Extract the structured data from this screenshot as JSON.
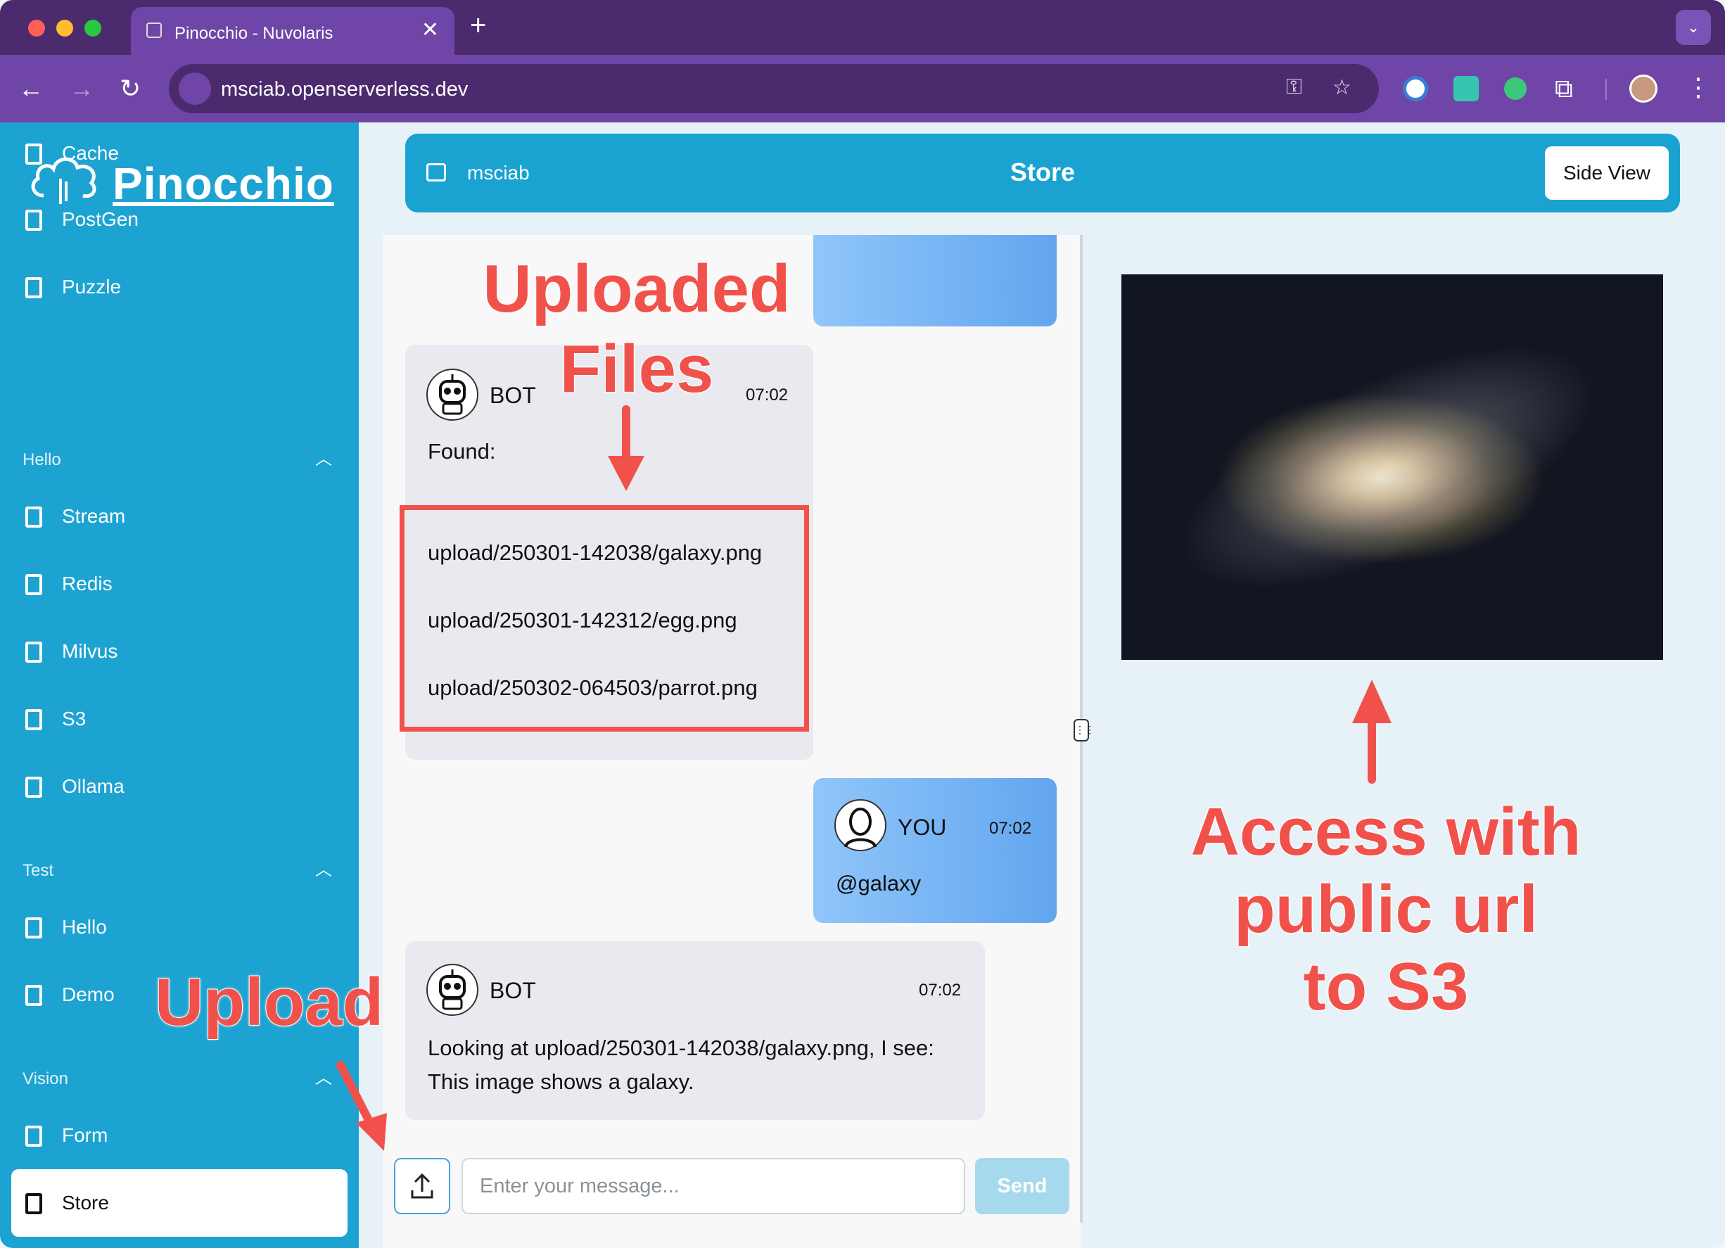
{
  "browser": {
    "tab_title": "Pinocchio - Nuvolaris",
    "url": "msciab.openserverless.dev"
  },
  "sidebar": {
    "logo_text": "Pinocchio",
    "items_top": [
      {
        "label": "Cache"
      },
      {
        "label": "PostGen"
      },
      {
        "label": "Puzzle"
      }
    ],
    "sections": [
      {
        "title": "Hello",
        "items": [
          {
            "label": "Stream"
          },
          {
            "label": "Redis"
          },
          {
            "label": "Milvus"
          },
          {
            "label": "S3"
          },
          {
            "label": "Ollama"
          }
        ]
      },
      {
        "title": "Test",
        "items": [
          {
            "label": "Hello"
          },
          {
            "label": "Demo"
          }
        ]
      },
      {
        "title": "Vision",
        "items": [
          {
            "label": "Form"
          },
          {
            "label": "Store"
          }
        ]
      }
    ],
    "active_item": "Store"
  },
  "header": {
    "workspace": "msciab",
    "page_title": "Store",
    "side_view_label": "Side View"
  },
  "chat": {
    "messages": [
      {
        "sender": "BOT",
        "time": "07:02",
        "text": "Found:",
        "files": [
          "upload/250301-142038/galaxy.png",
          "upload/250301-142312/egg.png",
          "upload/250302-064503/parrot.png"
        ]
      },
      {
        "sender": "YOU",
        "time": "07:02",
        "text": "@galaxy"
      },
      {
        "sender": "BOT",
        "time": "07:02",
        "text_line1": "Looking at upload/250301-142038/galaxy.png, I see:",
        "text_line2": "This image shows a galaxy."
      }
    ],
    "input_placeholder": "Enter your message...",
    "send_label": "Send"
  },
  "annotations": {
    "uploaded_files_line1": "Uploaded",
    "uploaded_files_line2": "Files",
    "upload": "Upload",
    "access_line1": "Access with",
    "access_line2": "public url",
    "access_line3": "to S3"
  },
  "colors": {
    "accent": "#1da3d1",
    "annotation": "#f0524b",
    "browser_frame": "#6f45a8"
  }
}
